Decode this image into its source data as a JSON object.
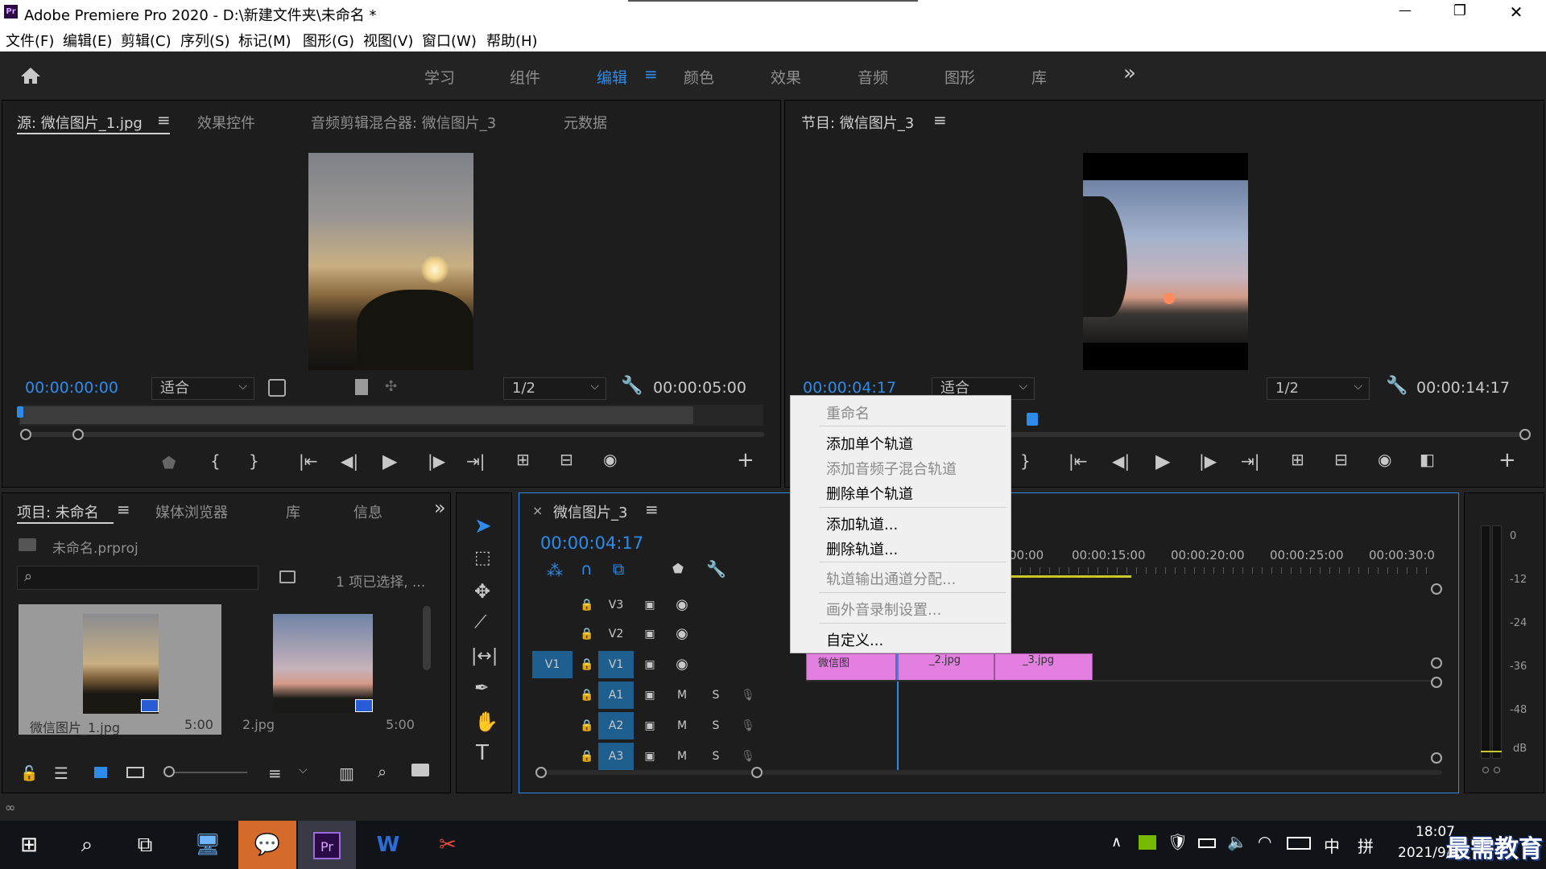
{
  "window": {
    "app_icon": "Pr",
    "title": "Adobe Premiere Pro 2020 - D:\\新建文件夹\\未命名 *",
    "minimize_icon": "—",
    "maximize_icon": "❐",
    "close_icon": "✕"
  },
  "menu": [
    "文件(F)",
    "编辑(E)",
    "剪辑(C)",
    "序列(S)",
    "标记(M)",
    "图形(G)",
    "视图(V)",
    "窗口(W)",
    "帮助(H)"
  ],
  "workspace": {
    "tabs": [
      "学习",
      "组件",
      "编辑",
      "颜色",
      "效果",
      "音频",
      "图形",
      "库"
    ],
    "active": "编辑",
    "more": "»"
  },
  "source_panel": {
    "tabs": [
      "源: 微信图片_1.jpg",
      "效果控件",
      "音频剪辑混合器: 微信图片_3",
      "元数据"
    ],
    "timecode": "00:00:00:00",
    "fit": "适合",
    "resolution": "1/2",
    "duration": "00:00:05:00"
  },
  "program_panel": {
    "title": "节目: 微信图片_3",
    "timecode": "00:00:04:17",
    "fit": "适合",
    "resolution": "1/2",
    "duration": "00:00:14:17"
  },
  "project_panel": {
    "tabs": [
      "项目: 未命名",
      "媒体浏览器",
      "库",
      "信息"
    ],
    "file": "未命名.prproj",
    "selection": "1 项已选择, ...",
    "items": [
      {
        "name": "微信图片_1.jpg",
        "duration": "5:00"
      },
      {
        "name": "2.jpg",
        "duration": "5:00"
      }
    ]
  },
  "timeline": {
    "title": "微信图片_3",
    "timecode": "00:00:04:17",
    "ruler": [
      "00:00",
      "00:00:15:00",
      "00:00:20:00",
      "00:00:25:00",
      "00:00:30:0"
    ],
    "video_tracks": [
      "V3",
      "V2",
      "V1"
    ],
    "audio_tracks": [
      "A1",
      "A2",
      "A3"
    ],
    "source_patch": "V1",
    "m_label": "M",
    "s_label": "S",
    "clips": [
      "微信图",
      "_2.jpg",
      "_3.jpg"
    ]
  },
  "context_menu": {
    "items": [
      {
        "label": "重命名",
        "enabled": false
      },
      {
        "label": "添加单个轨道",
        "enabled": true
      },
      {
        "label": "添加音频子混合轨道",
        "enabled": false
      },
      {
        "label": "删除单个轨道",
        "enabled": true
      },
      {
        "label": "添加轨道...",
        "enabled": true
      },
      {
        "label": "删除轨道...",
        "enabled": true
      },
      {
        "label": "轨道输出通道分配...",
        "enabled": false
      },
      {
        "label": "画外音录制设置...",
        "enabled": false
      },
      {
        "label": "自定义...",
        "enabled": true
      }
    ]
  },
  "audio_meter": {
    "scale": [
      "0",
      "-12",
      "-24",
      "-36",
      "-48",
      "dB"
    ]
  },
  "taskbar": {
    "clock_time": "18:07",
    "clock_date": "2021/9/26",
    "ime_lang": "中",
    "ime_mode": "拼",
    "watermark": "最需教育"
  },
  "colors": {
    "accent_blue": "#2d8ceb",
    "clip_pink": "#e27fe1",
    "panel_bg": "#1d1d1d",
    "track_blue": "#1f5f8f"
  }
}
